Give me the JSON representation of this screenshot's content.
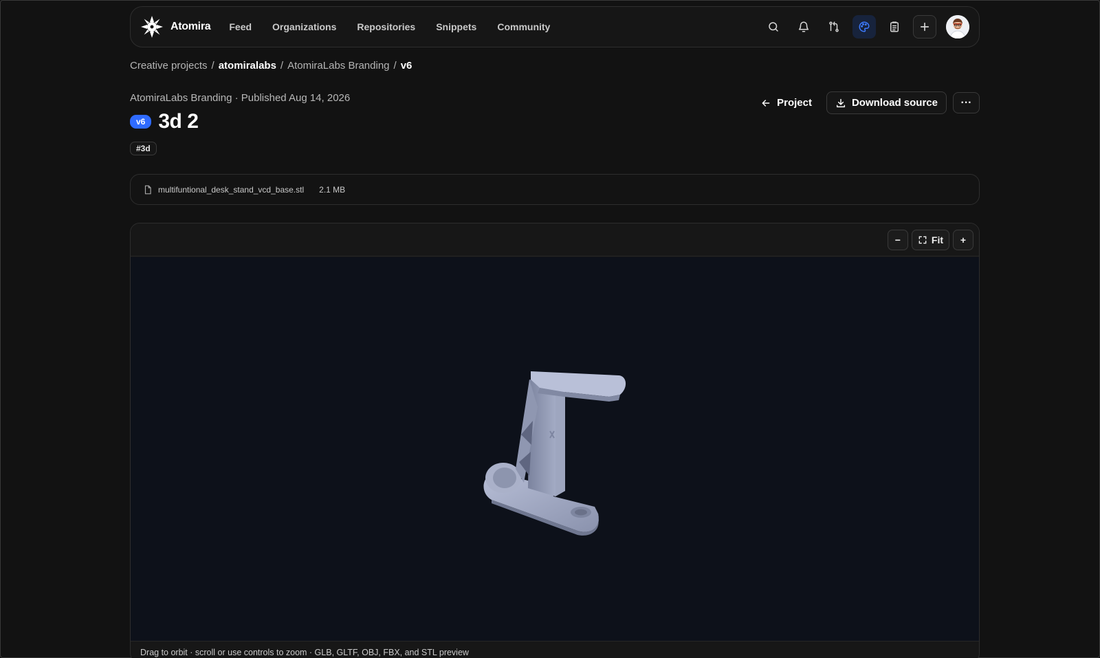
{
  "nav": {
    "brand": "Atomira",
    "links": [
      "Feed",
      "Organizations",
      "Repositories",
      "Snippets",
      "Community"
    ],
    "icons": [
      "search-icon",
      "bell-icon",
      "pull-request-icon",
      "palette-icon",
      "clipboard-icon",
      "plus-icon"
    ],
    "active_icon": "palette-icon"
  },
  "breadcrumb": {
    "items": [
      "Creative projects",
      "atomiralabs",
      "AtomiraLabs Branding",
      "v6"
    ],
    "separator": "/"
  },
  "header": {
    "meta": "AtomiraLabs Branding · Published Aug 14, 2026",
    "version": "v6",
    "title": "3d 2",
    "tag": "#3d",
    "project_label": "Project",
    "download_label": "Download source",
    "more_label": "···"
  },
  "file": {
    "name": "multifuntional_desk_stand_vcd_base.stl",
    "size": "2.1 MB"
  },
  "viewer": {
    "zoom_out": "−",
    "fit_label": "Fit",
    "zoom_in": "+",
    "caption": "Drag to orbit · scroll or use controls to zoom · GLB, GLTF, OBJ, FBX, and STL preview",
    "background": "#0d111a",
    "model_color": "#9aa3be"
  },
  "colors": {
    "accent": "#2f6bff",
    "page_bg": "#121212"
  }
}
